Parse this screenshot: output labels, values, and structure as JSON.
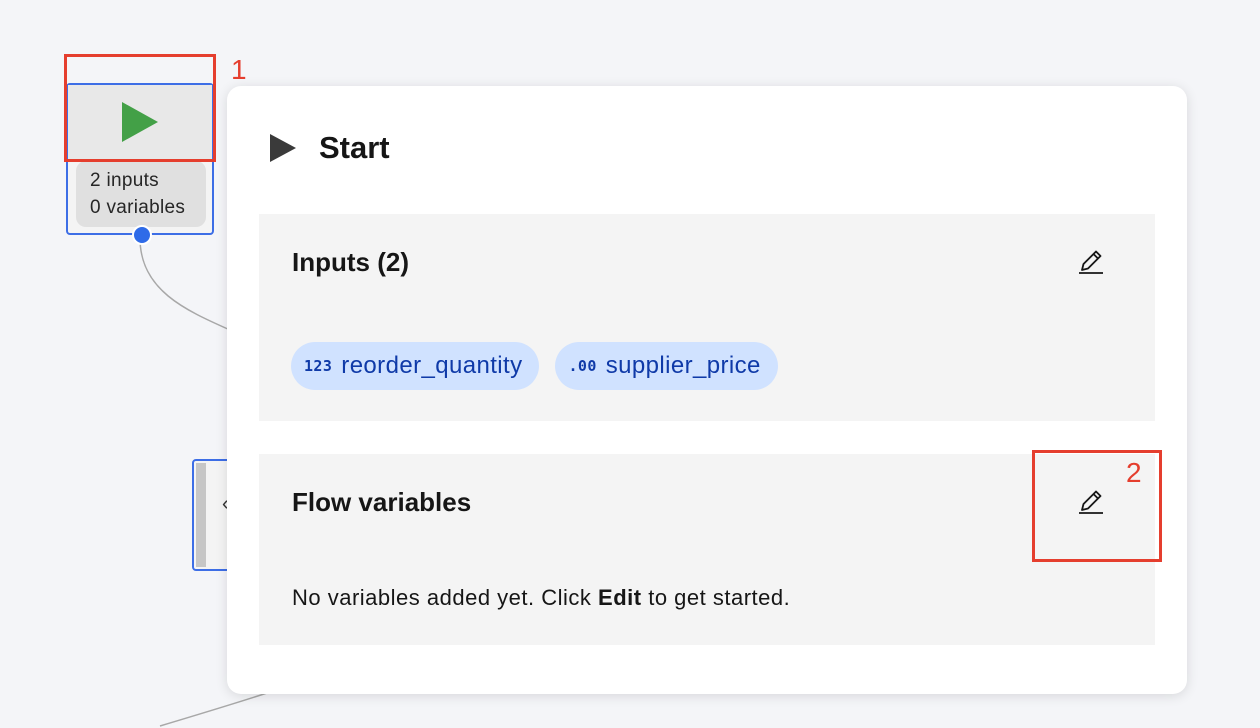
{
  "start_node": {
    "inputs_count_label": "2 inputs",
    "variables_count_label": "0 variables"
  },
  "panel": {
    "title": "Start",
    "inputs_section": {
      "title": "Inputs (2)",
      "edit_icon": "pencil-icon",
      "inputs": [
        {
          "type_icon": "123",
          "name": "reorder_quantity"
        },
        {
          "type_icon": ".00",
          "name": "supplier_price"
        }
      ]
    },
    "flow_variables_section": {
      "title": "Flow variables",
      "edit_icon": "pencil-icon",
      "empty_text_before": "No variables added yet. Click ",
      "empty_text_bold": "Edit",
      "empty_text_after": " to get started."
    }
  },
  "annotations": [
    {
      "label": "1"
    },
    {
      "label": "2"
    }
  ],
  "colors": {
    "node_border": "#3d6ee6",
    "play_green": "#43a047",
    "annotation_red": "#e53e2e",
    "tag_bg": "#d0e2ff",
    "tag_text": "#0f3aa8"
  }
}
